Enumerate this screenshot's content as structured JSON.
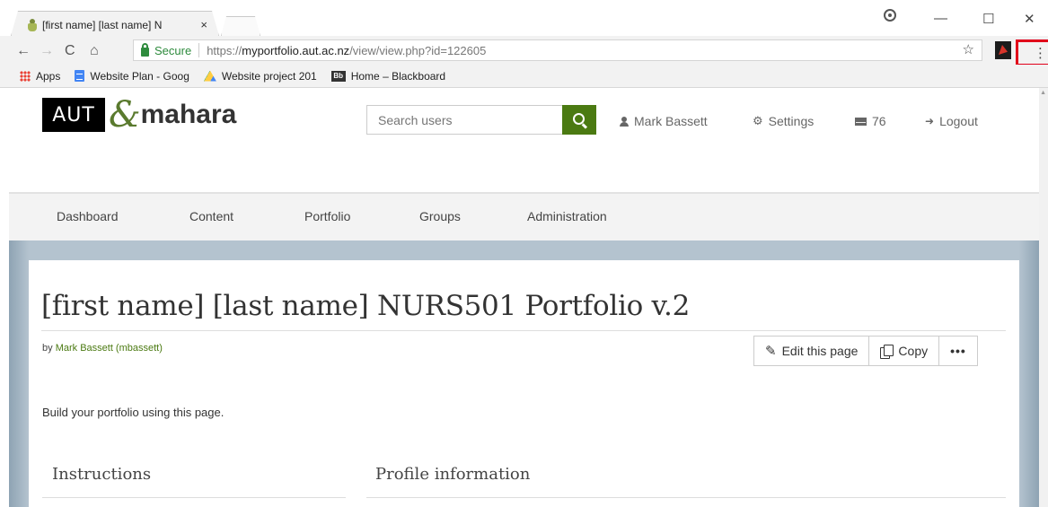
{
  "browser": {
    "tab_title": "[first name] [last name] N",
    "tab_close": "×",
    "window_min": "—",
    "window_max": "☐",
    "window_close": "✕",
    "nav_back": "←",
    "nav_forward": "→",
    "nav_reload": "C",
    "nav_home": "⌂",
    "secure_label": "Secure",
    "url_scheme": "https://",
    "url_host": "myportfolio.aut.ac.nz",
    "url_path": "/view/view.php?id=122605",
    "star": "☆",
    "menu": "⋮",
    "bookmarks": [
      {
        "label": "Apps",
        "icon": "apps-icon"
      },
      {
        "label": "Website Plan - Goog",
        "icon": "docs-icon"
      },
      {
        "label": "Website project 201",
        "icon": "drive-icon"
      },
      {
        "label": "Home – Blackboard",
        "icon": "blackboard-icon"
      }
    ],
    "blackboard_badge": "Bb"
  },
  "site": {
    "logo_aut": "AUT",
    "logo_amp": "&",
    "logo_name": "mahara",
    "search_placeholder": "Search users",
    "user_name": "Mark Bassett",
    "settings_label": "Settings",
    "settings_icon": "⚙",
    "inbox_count": "76",
    "logout_label": "Logout",
    "logout_icon": "➜",
    "nav": [
      "Dashboard",
      "Content",
      "Portfolio",
      "Groups",
      "Administration"
    ],
    "accent_color": "#4b7a12"
  },
  "page": {
    "title": "[first name] [last name] NURS501 Portfolio v.2",
    "by_prefix": "by ",
    "author": "Mark Bassett (mbassett)",
    "edit_label": "Edit this page",
    "edit_icon": "✎",
    "copy_label": "Copy",
    "more_label": "•••",
    "description": "Build your portfolio using this page.",
    "blocks": [
      "Instructions",
      "Profile information"
    ]
  }
}
